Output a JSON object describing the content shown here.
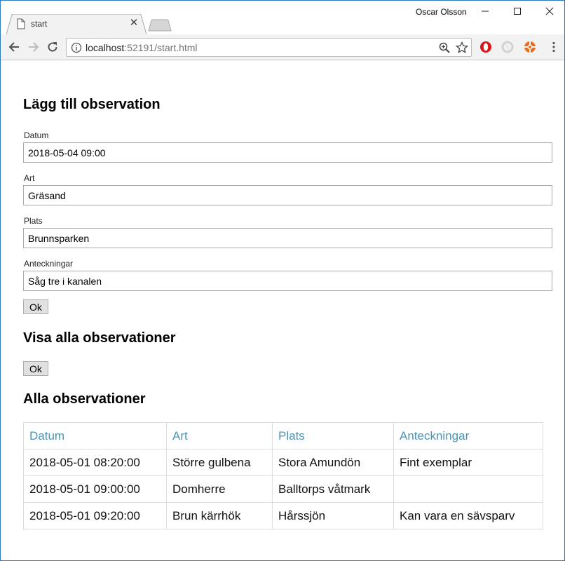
{
  "browser": {
    "tab_title": "start",
    "profile_name": "Oscar Olsson",
    "url_host": "localhost",
    "url_rest": ":52191/start.html"
  },
  "add_section": {
    "heading": "Lägg till observation",
    "fields": {
      "datum": {
        "label": "Datum",
        "value": "2018-05-04 09:00"
      },
      "art": {
        "label": "Art",
        "value": "Gräsand"
      },
      "plats": {
        "label": "Plats",
        "value": "Brunnsparken"
      },
      "anteckningar": {
        "label": "Anteckningar",
        "value": "Såg tre i kanalen"
      }
    },
    "ok_label": "Ok"
  },
  "show_section": {
    "heading": "Visa alla observationer",
    "ok_label": "Ok"
  },
  "table_section": {
    "heading": "Alla observationer",
    "columns": [
      "Datum",
      "Art",
      "Plats",
      "Anteckningar"
    ],
    "rows": [
      [
        "2018-05-01 08:20:00",
        "Större gulbena",
        "Stora Amundön",
        "Fint exemplar"
      ],
      [
        "2018-05-01 09:00:00",
        "Domherre",
        "Balltorps våtmark",
        ""
      ],
      [
        "2018-05-01 09:20:00",
        "Brun kärrhök",
        "Hårssjön",
        "Kan vara en sävsparv"
      ]
    ]
  },
  "colors": {
    "header_text": "#4b93b5",
    "window_border": "#2b79c2"
  }
}
